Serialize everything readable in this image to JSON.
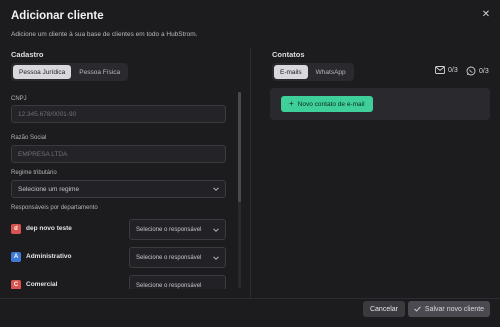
{
  "header": {
    "title": "Adicionar cliente",
    "subtitle": "Adicione um cliente à sua base de clientes em todo a HubStrom.",
    "close_glyph": "✕"
  },
  "cadastro": {
    "section_title": "Cadastro",
    "tabs": [
      {
        "label": "Pessoa Jurídica",
        "active": true
      },
      {
        "label": "Pessoa Física",
        "active": false
      }
    ],
    "cnpj": {
      "label": "CNPJ",
      "placeholder": "12.345.678/0001-90"
    },
    "razao_social": {
      "label": "Razão Social",
      "placeholder": "EMPRESA LTDA"
    },
    "regime": {
      "label": "Regime tributário",
      "value": "Selecione um regime"
    },
    "responsaveis_label": "Responsáveis por departamento",
    "departments": [
      {
        "badge": "d",
        "name": "dep novo teste",
        "badge_color": "#d9534f",
        "select": "Selecione o responsável"
      },
      {
        "badge": "A",
        "name": "Administrativo",
        "badge_color": "#3d7bd6",
        "select": "Selecione o responsável"
      },
      {
        "badge": "C",
        "name": "Comercial",
        "badge_color": "#d9534f",
        "select": "Selecione o responsável"
      }
    ]
  },
  "contatos": {
    "section_title": "Contatos",
    "tabs": [
      {
        "label": "E-mails",
        "active": true
      },
      {
        "label": "WhatsApp",
        "active": false
      }
    ],
    "email_count": "0/3",
    "whatsapp_count": "0/3",
    "add_email_label": "Novo contato de e-mail",
    "accent_color": "#3ecf9a"
  },
  "footer": {
    "cancel_label": "Cancelar",
    "save_label": "Salvar novo cliente"
  }
}
